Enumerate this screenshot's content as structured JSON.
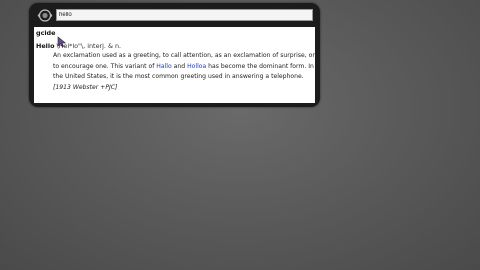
{
  "search": {
    "value": "hello"
  },
  "result": {
    "database": "gcide",
    "headword": "Hello",
    "pronunciation": "\\Hel*lo\"\\,",
    "pos": "interj. & n.",
    "definition_part1": "An exclamation used as a greeting, to call attention, as an exclamation of surprise, or to encourage one. This variant of ",
    "link1": "Hallo",
    "definition_part2": " and ",
    "link2": "Holloa",
    "definition_part3": " has become the dominant form. In the United States, it is the most common greeting used in answering a telephone. ",
    "source": "[1913 Webster +PJC]"
  },
  "icons": {
    "app": "dictionary-app-icon",
    "cursor": "mouse-pointer-icon"
  },
  "colors": {
    "link": "#1a3cc8",
    "window": "#1c1c1c",
    "background": "#5b5b5b"
  }
}
